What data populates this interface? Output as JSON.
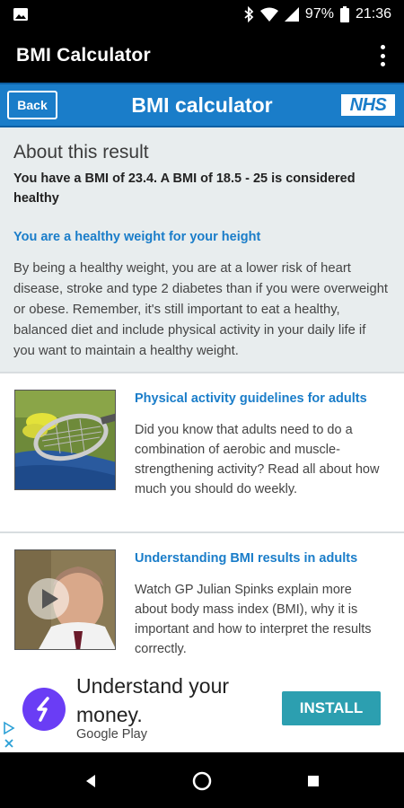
{
  "status_bar": {
    "battery": "97%",
    "time": "21:36"
  },
  "app_bar": {
    "title": "BMI Calculator"
  },
  "header": {
    "back_label": "Back",
    "title": "BMI calculator",
    "logo_text": "NHS"
  },
  "result": {
    "heading": "About this result",
    "summary": "You have a BMI of 23.4. A BMI of 18.5 - 25 is considered healthy",
    "status": "You are a healthy weight for your height",
    "body": "By being a healthy weight, you are at a lower risk of heart disease, stroke and type 2 diabetes than if you were overweight or obese. Remember, it's still important to eat a healthy, balanced diet and include physical activity in your daily life if you want to maintain a healthy weight."
  },
  "cards": [
    {
      "title": "Physical activity guidelines for adults",
      "text": "Did you know that adults need to do a combination of aerobic and muscle-strengthening activity? Read all about how much you should do weekly."
    },
    {
      "title": "Understanding BMI results in adults",
      "text": "Watch GP Julian Spinks explain more about body mass index (BMI), why it is important and how to interpret the results correctly."
    }
  ],
  "ad": {
    "headline": "Understand your money.",
    "store": "Google Play",
    "install_label": "INSTALL"
  },
  "colors": {
    "nhs_blue": "#1a7dc9",
    "panel_grey": "#e8edee",
    "install_teal": "#2c9fb0",
    "ad_logo_purple": "#6a3df5"
  },
  "icons": [
    "image-notification-icon",
    "bluetooth-icon",
    "wifi-icon",
    "signal-icon",
    "battery-icon",
    "overflow-menu-icon",
    "play-icon",
    "ad-choices-icon",
    "back-nav-icon",
    "home-nav-icon",
    "recents-nav-icon"
  ]
}
